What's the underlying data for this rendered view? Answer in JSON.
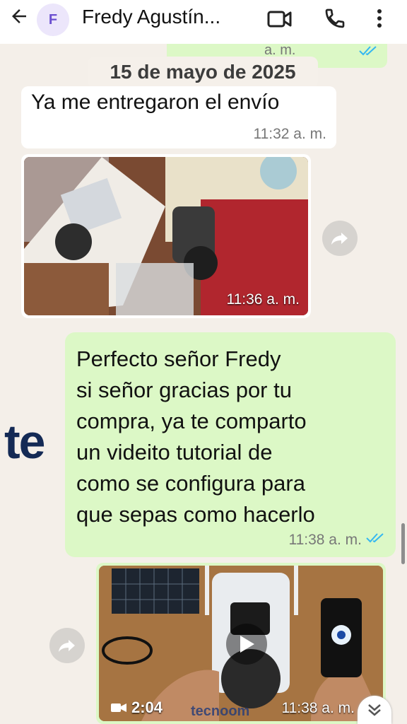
{
  "header": {
    "avatar_letter": "F",
    "contact_name": "Fredy Agustín...",
    "icons": [
      "back-arrow-icon",
      "video-call-icon",
      "phone-icon",
      "more-vert-icon"
    ]
  },
  "previous_message": {
    "time": "a. m."
  },
  "date_separator": "15 de mayo de 2025",
  "messages": [
    {
      "text": "Ya me entregaron el envío",
      "time": "11:32 a. m."
    },
    {
      "type": "image",
      "time": "11:36 a. m."
    },
    {
      "text": "Perfecto señor Fredy\nsi señor gracias por tu\ncompra, ya te comparto\nun videito tutorial de\ncomo se configura para\nque sepas como hacerlo",
      "time": "11:38 a. m."
    },
    {
      "type": "video",
      "duration": "2:04",
      "time": "11:38 a. m."
    }
  ],
  "watermark": {
    "text": "te",
    "video_text": "tecnoom"
  },
  "colors": {
    "outgoing": "#dcf8c6",
    "incoming": "#ffffff",
    "tick": "#34b7f1",
    "background": "#f4efe9"
  }
}
